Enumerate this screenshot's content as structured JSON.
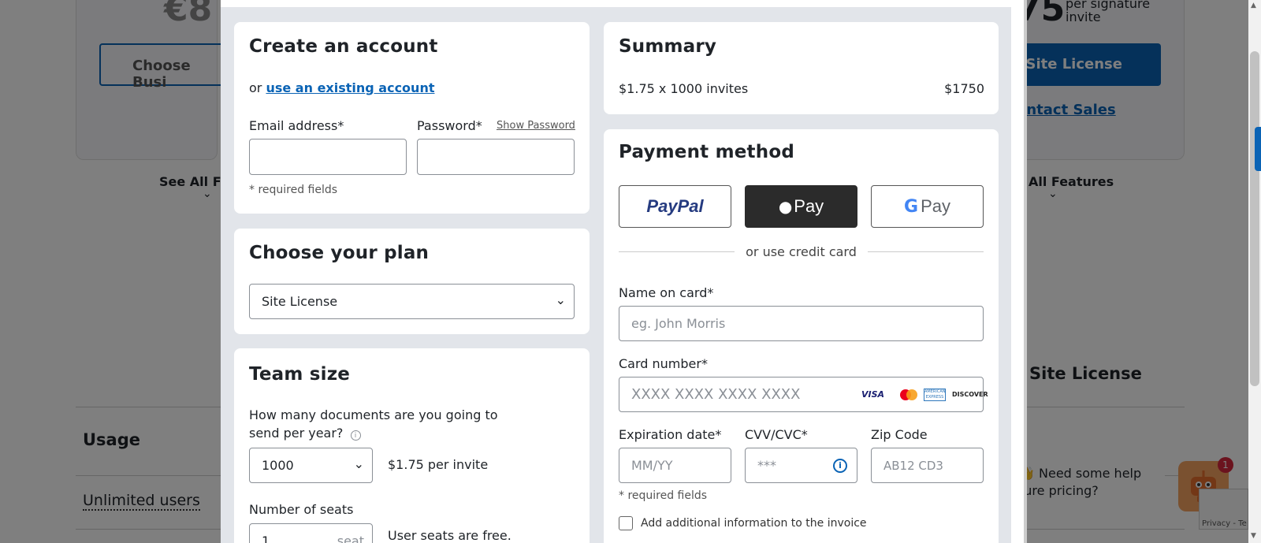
{
  "background": {
    "price_left": "€8",
    "price_right": "75",
    "per_signature": "per signature invite",
    "choose_business": "Choose Busi",
    "site_license_btn": "e Site License",
    "contact_sales": "ontact Sales",
    "see_all_left": "See All Fea",
    "see_all_right": "All Features",
    "site_license_heading": "Site License",
    "usage": "Usage",
    "unlimited_users": "Unlimited users",
    "chat_text_1": "👋 Need some help",
    "chat_text_2": "ture pricing?",
    "chat_badge": "1",
    "recaptcha": "Privacy - Te"
  },
  "account": {
    "title": "Create an account",
    "or_text": "or",
    "existing_link": "use an existing account",
    "email_label": "Email address*",
    "password_label": "Password*",
    "show_password": "Show Password",
    "required_note": "* required fields"
  },
  "plan": {
    "title": "Choose your plan",
    "selected": "Site License"
  },
  "team": {
    "title": "Team size",
    "question": "How many documents are you going to send per year?",
    "docs_selected": "1000",
    "per_invite": "$1.75 per invite",
    "seats_label": "Number of seats",
    "seats_value": "1",
    "seats_suffix": "seat",
    "seats_note": "User seats are free."
  },
  "summary": {
    "title": "Summary",
    "line": "$1.75 x 1000 invites",
    "total": "$1750"
  },
  "payment": {
    "title": "Payment method",
    "paypal": "PayPal",
    "applepay": "Pay",
    "gpay": "Pay",
    "divider": "or use credit card",
    "name_label": "Name on card*",
    "name_placeholder": "eg. John Morris",
    "card_label": "Card number*",
    "card_placeholder": "XXXX XXXX XXXX XXXX",
    "card_brands": [
      "VISA",
      "mastercard",
      "AMERICAN EXPRESS",
      "DISCOVER"
    ],
    "exp_label": "Expiration date*",
    "exp_placeholder": "MM/YY",
    "cvv_label": "CVV/CVC*",
    "cvv_placeholder": "***",
    "zip_label": "Zip Code",
    "zip_placeholder": "AB12 CD3",
    "required_note": "* required fields",
    "extra_info": "Add additional information to the invoice"
  },
  "colors": {
    "accent": "#0a63b5",
    "apple_bg": "#2b2b2b",
    "overlay": "#7b7b7b"
  }
}
